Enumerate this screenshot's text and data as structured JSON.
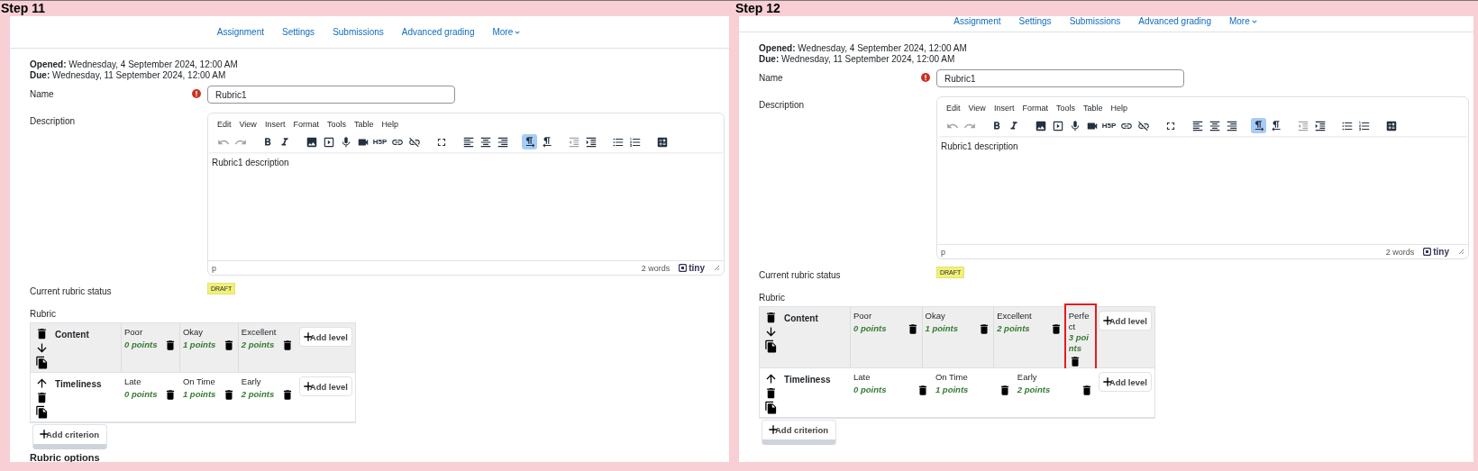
{
  "panels": [
    {
      "step": "Step 11",
      "nav_partly_hidden": false,
      "nav": [
        {
          "label": "Assignment",
          "dropdown": false
        },
        {
          "label": "Settings",
          "dropdown": false
        },
        {
          "label": "Submissions",
          "dropdown": false
        },
        {
          "label": "Advanced grading",
          "dropdown": false
        },
        {
          "label": "More",
          "dropdown": true
        }
      ],
      "dates": [
        {
          "label": "Opened:",
          "value": "Wednesday, 4 September 2024, 12:00 AM"
        },
        {
          "label": "Due:",
          "value": "Wednesday, 11 September 2024, 12:00 AM"
        }
      ],
      "name_label": "Name",
      "name_required": true,
      "name_value": "Rubric1",
      "description_label": "Description",
      "editor": {
        "menu": [
          "Edit",
          "View",
          "Insert",
          "Format",
          "Tools",
          "Table",
          "Help"
        ],
        "toolbar": [
          [
            {
              "kind": "undo",
              "disabled": true,
              "selected": false
            },
            {
              "kind": "redo",
              "disabled": true,
              "selected": false
            }
          ],
          [
            {
              "kind": "bold",
              "disabled": false,
              "selected": false
            },
            {
              "kind": "italic",
              "disabled": false,
              "selected": false
            }
          ],
          [
            {
              "kind": "image",
              "disabled": false,
              "selected": false
            },
            {
              "kind": "media",
              "disabled": false,
              "selected": false
            },
            {
              "kind": "microphone",
              "disabled": false,
              "selected": false
            },
            {
              "kind": "video",
              "disabled": false,
              "selected": false
            },
            {
              "kind": "h5p",
              "disabled": false,
              "selected": false,
              "label": "H5P"
            },
            {
              "kind": "link",
              "disabled": false,
              "selected": false
            },
            {
              "kind": "unlink",
              "disabled": false,
              "selected": false
            }
          ],
          [
            {
              "kind": "fullscreen",
              "disabled": false,
              "selected": false
            }
          ],
          [
            {
              "kind": "align-left",
              "disabled": false,
              "selected": false
            },
            {
              "kind": "align-center",
              "disabled": false,
              "selected": false
            },
            {
              "kind": "align-right",
              "disabled": false,
              "selected": false
            }
          ],
          [
            {
              "kind": "ltr",
              "disabled": false,
              "selected": true
            },
            {
              "kind": "rtl",
              "disabled": false,
              "selected": false
            }
          ],
          [
            {
              "kind": "outdent",
              "disabled": true,
              "selected": false
            },
            {
              "kind": "indent",
              "disabled": false,
              "selected": false
            }
          ],
          [
            {
              "kind": "bullet-list",
              "disabled": false,
              "selected": false
            },
            {
              "kind": "numbered-list",
              "disabled": false,
              "selected": false
            }
          ],
          [
            {
              "kind": "calculator",
              "disabled": false,
              "selected": false
            }
          ]
        ],
        "content": "Rubric1 description",
        "path": "p",
        "word_count": "2 words",
        "brand": "tiny"
      },
      "status_label": "Current rubric status",
      "status": "DRAFT",
      "rubric_label": "Rubric",
      "criteria": [
        {
          "name": "Content",
          "actions": [
            {
              "kind": "delete"
            },
            {
              "kind": "move-down"
            },
            {
              "kind": "duplicate"
            }
          ],
          "shaded": true,
          "levels": [
            {
              "definition": "Poor",
              "score": "0 points",
              "highlighted": false
            },
            {
              "definition": "Okay",
              "score": "1 points",
              "highlighted": false
            },
            {
              "definition": "Excellent",
              "score": "2 points",
              "highlighted": false
            }
          ],
          "add_level": "Add level"
        },
        {
          "name": "Timeliness",
          "actions": [
            {
              "kind": "move-up"
            },
            {
              "kind": "delete"
            },
            {
              "kind": "duplicate"
            }
          ],
          "shaded": false,
          "levels": [
            {
              "definition": "Late",
              "score": "0 points",
              "highlighted": false
            },
            {
              "definition": "On Time",
              "score": "1 points",
              "highlighted": false
            },
            {
              "definition": "Early",
              "score": "2 points",
              "highlighted": false
            }
          ],
          "add_level": "Add level"
        }
      ],
      "add_criterion": "Add criterion",
      "options_heading": "Rubric options"
    },
    {
      "step": "Step 12",
      "nav_partly_hidden": true,
      "nav": [
        {
          "label": "Assignment",
          "dropdown": false
        },
        {
          "label": "Settings",
          "dropdown": false
        },
        {
          "label": "Submissions",
          "dropdown": false
        },
        {
          "label": "Advanced grading",
          "dropdown": false
        },
        {
          "label": "More",
          "dropdown": true
        }
      ],
      "dates": [
        {
          "label": "Opened:",
          "value": "Wednesday, 4 September 2024, 12:00 AM"
        },
        {
          "label": "Due:",
          "value": "Wednesday, 11 September 2024, 12:00 AM"
        }
      ],
      "name_label": "Name",
      "name_required": true,
      "name_value": "Rubric1",
      "description_label": "Description",
      "editor": {
        "menu": [
          "Edit",
          "View",
          "Insert",
          "Format",
          "Tools",
          "Table",
          "Help"
        ],
        "toolbar": [
          [
            {
              "kind": "undo",
              "disabled": true,
              "selected": false
            },
            {
              "kind": "redo",
              "disabled": true,
              "selected": false
            }
          ],
          [
            {
              "kind": "bold",
              "disabled": false,
              "selected": false
            },
            {
              "kind": "italic",
              "disabled": false,
              "selected": false
            }
          ],
          [
            {
              "kind": "image",
              "disabled": false,
              "selected": false
            },
            {
              "kind": "media",
              "disabled": false,
              "selected": false
            },
            {
              "kind": "microphone",
              "disabled": false,
              "selected": false
            },
            {
              "kind": "video",
              "disabled": false,
              "selected": false
            },
            {
              "kind": "h5p",
              "disabled": false,
              "selected": false,
              "label": "H5P"
            },
            {
              "kind": "link",
              "disabled": false,
              "selected": false
            },
            {
              "kind": "unlink",
              "disabled": false,
              "selected": false
            }
          ],
          [
            {
              "kind": "fullscreen",
              "disabled": false,
              "selected": false
            }
          ],
          [
            {
              "kind": "align-left",
              "disabled": false,
              "selected": false
            },
            {
              "kind": "align-center",
              "disabled": false,
              "selected": false
            },
            {
              "kind": "align-right",
              "disabled": false,
              "selected": false
            }
          ],
          [
            {
              "kind": "ltr",
              "disabled": false,
              "selected": true
            },
            {
              "kind": "rtl",
              "disabled": false,
              "selected": false
            }
          ],
          [
            {
              "kind": "outdent",
              "disabled": true,
              "selected": false
            },
            {
              "kind": "indent",
              "disabled": false,
              "selected": false
            }
          ],
          [
            {
              "kind": "bullet-list",
              "disabled": false,
              "selected": false
            },
            {
              "kind": "numbered-list",
              "disabled": false,
              "selected": false
            }
          ],
          [
            {
              "kind": "calculator",
              "disabled": false,
              "selected": false
            }
          ]
        ],
        "content": "Rubric1 description",
        "path": "p",
        "word_count": "2 words",
        "brand": "tiny"
      },
      "status_label": "Current rubric status",
      "status": "DRAFT",
      "rubric_label": "Rubric",
      "criteria": [
        {
          "name": "Content",
          "actions": [
            {
              "kind": "delete"
            },
            {
              "kind": "move-down"
            },
            {
              "kind": "duplicate"
            }
          ],
          "shaded": true,
          "levels": [
            {
              "definition": "Poor",
              "score": "0 points",
              "highlighted": false
            },
            {
              "definition": "Okay",
              "score": "1 points",
              "highlighted": false
            },
            {
              "definition": "Excellent",
              "score": "2 points",
              "highlighted": false
            },
            {
              "definition": "Perfect",
              "score": "3 points",
              "highlighted": true
            }
          ],
          "add_level": "Add level"
        },
        {
          "name": "Timeliness",
          "actions": [
            {
              "kind": "move-up"
            },
            {
              "kind": "delete"
            },
            {
              "kind": "duplicate"
            }
          ],
          "shaded": false,
          "levels": [
            {
              "definition": "Late",
              "score": "0 points",
              "highlighted": false
            },
            {
              "definition": "On Time",
              "score": "1 points",
              "highlighted": false
            },
            {
              "definition": "Early",
              "score": "2 points",
              "highlighted": false
            }
          ],
          "add_level": "Add level"
        }
      ],
      "add_criterion": "Add criterion"
    }
  ]
}
